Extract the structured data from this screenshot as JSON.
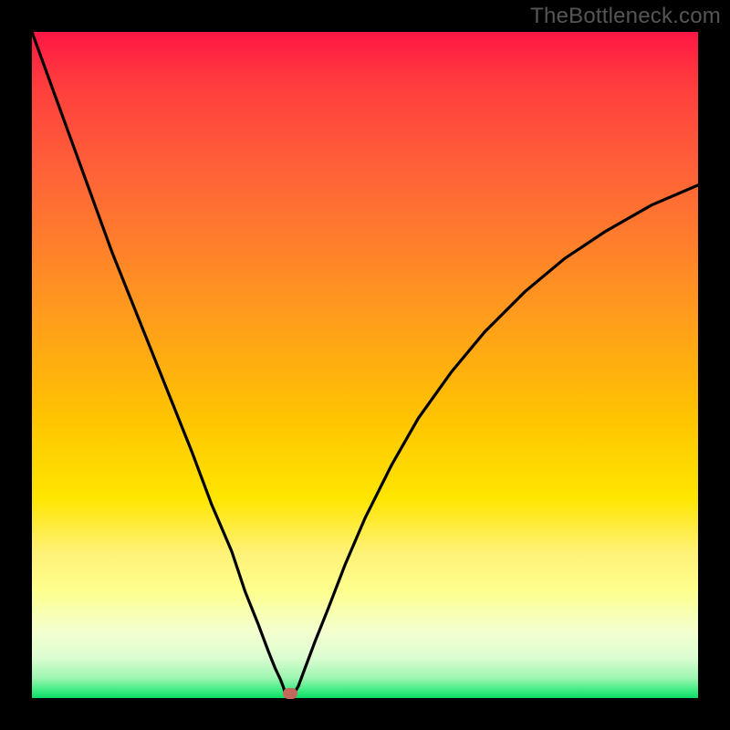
{
  "watermark": "TheBottleneck.com",
  "colors": {
    "frame": "#000000",
    "curve": "#000000",
    "marker": "#c3695c"
  },
  "chart_data": {
    "type": "line",
    "title": "",
    "xlabel": "",
    "ylabel": "",
    "xlim": [
      0,
      100
    ],
    "ylim": [
      0,
      100
    ],
    "gradient_meaning": "top=red=bad, bottom=green=good",
    "series": [
      {
        "name": "left-branch",
        "x": [
          0,
          4,
          8,
          12,
          16,
          20,
          24,
          27,
          30,
          32,
          34,
          35.5,
          36.5,
          37.3,
          37.8,
          38.0,
          38.3
        ],
        "y": [
          100,
          89,
          78,
          67,
          57,
          47,
          37,
          29,
          22,
          16,
          11,
          7,
          4.5,
          2.8,
          1.5,
          0.6,
          0.0
        ]
      },
      {
        "name": "right-branch",
        "x": [
          38.8,
          39.3,
          40,
          41,
          42.5,
          44.5,
          47,
          50,
          54,
          58,
          63,
          68,
          74,
          80,
          86,
          93,
          100
        ],
        "y": [
          0.0,
          0.6,
          1.8,
          4.5,
          8.5,
          13.5,
          20,
          27,
          35,
          42,
          49,
          55,
          61,
          66,
          70,
          74,
          77
        ]
      }
    ],
    "marker": {
      "x": 38.8,
      "y": 0.7
    }
  }
}
